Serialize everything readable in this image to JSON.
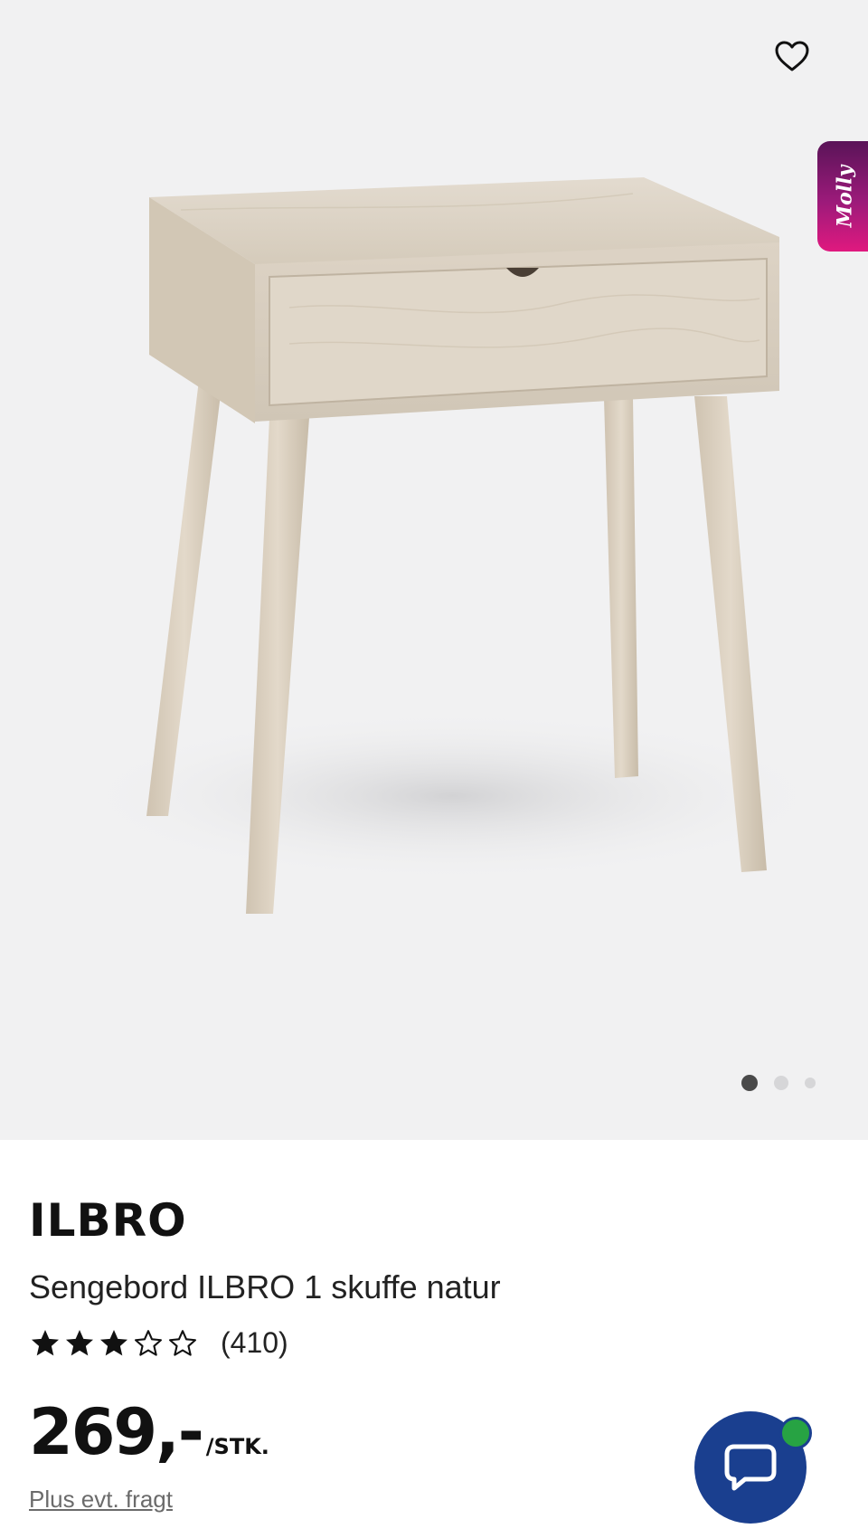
{
  "gallery": {
    "image_alt": "Sengebord ILBRO 1 skuffe natur",
    "favorite_icon": "heart-outline-icon",
    "dots": [
      {
        "active": true
      },
      {
        "active": false
      },
      {
        "active": false
      }
    ]
  },
  "molly": {
    "label": "Molly"
  },
  "product": {
    "brand": "ILBRO",
    "name": "Sengebord ILBRO 1 skuffe natur",
    "rating": {
      "stars": 3,
      "max": 5,
      "count_text": "(410)"
    },
    "price": "269,-",
    "unit": "/STK.",
    "shipping": "Plus evt. fragt"
  },
  "chat": {
    "icon": "chat-bubble-icon",
    "status_color": "#27a343"
  },
  "colors": {
    "chat_blue": "#1a3f8f",
    "gallery_bg": "#f1f1f2"
  }
}
